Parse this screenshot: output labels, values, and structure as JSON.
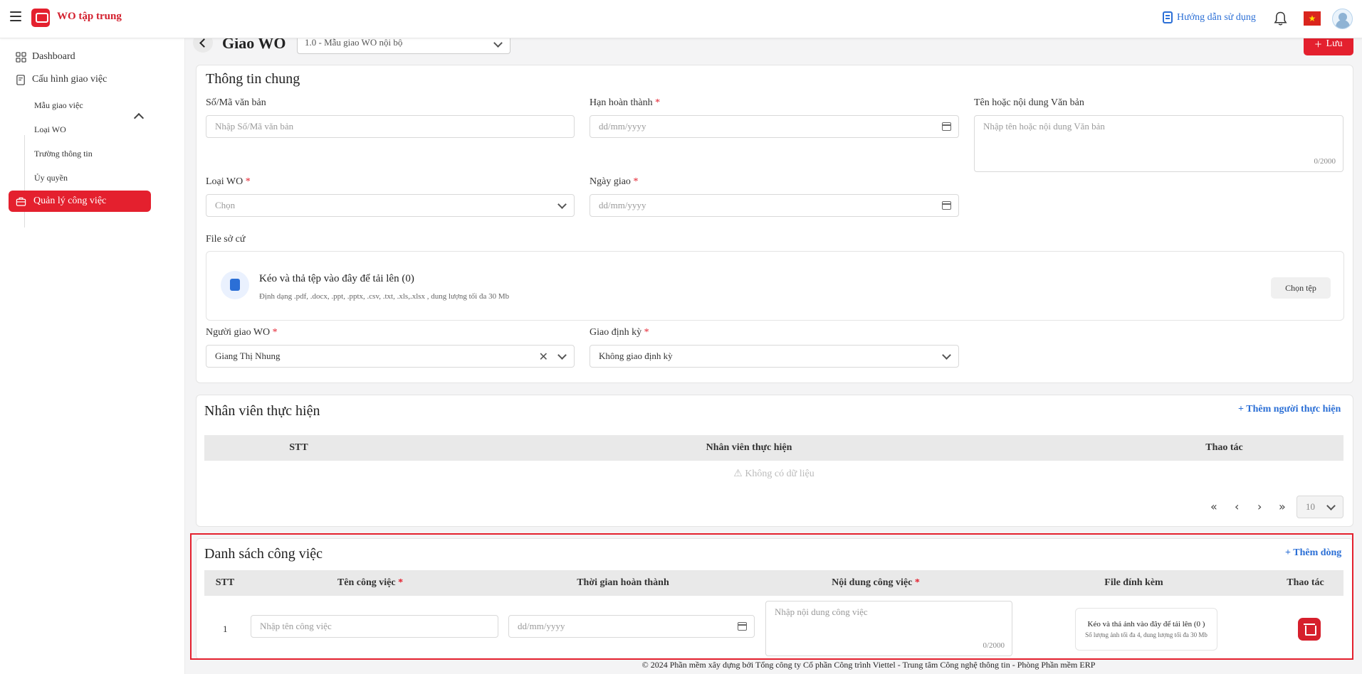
{
  "header": {
    "app_title": "WO tập trung",
    "guide_label": "Hướng dẫn sử dụng",
    "flag_symbol": "★",
    "brand_color": "#e4202e"
  },
  "sidebar": {
    "dashboard": "Dashboard",
    "config": "Cấu hình giao việc",
    "sub_items": [
      "Mẫu giao việc",
      "Loại WO",
      "Trường thông tin",
      "Ủy quyền"
    ],
    "active": "Quản lý công việc"
  },
  "page": {
    "title": "Giao WO",
    "template_value": "1.0 - Mẫu giao WO nội bộ",
    "save_label": "Lưu",
    "save_icon": "+"
  },
  "general": {
    "title": "Thông tin chung",
    "doc_no_label": "Số/Mã văn bản",
    "doc_no_placeholder": "Nhập Số/Mã văn bản",
    "deadline_label": "Hạn hoàn thành",
    "deadline_placeholder": "dd/mm/yyyy",
    "doc_name_label": "Tên hoặc nội dung Văn bản",
    "doc_name_placeholder": "Nhập tên hoặc nội dung Văn bản",
    "doc_name_counter": "0/2000",
    "wo_type_label": "Loại WO",
    "wo_type_placeholder": "Chọn",
    "assign_date_label": "Ngày giao",
    "assign_date_placeholder": "dd/mm/yyyy",
    "file_label": "File sở cứ",
    "dropzone_title": "Kéo và thả tệp vào đây để tải lên (0)",
    "dropzone_sub": "Định dạng .pdf, .docx, .ppt, .pptx, .csv, .txt, .xls,.xlsx , dung lượng tối đa 30 Mb",
    "choose_file": "Chọn tệp",
    "assigner_label": "Người giao WO",
    "assigner_value": "Giang Thị Nhung",
    "periodic_label": "Giao định kỳ",
    "periodic_value": "Không giao định kỳ",
    "required_mark": "*"
  },
  "staff": {
    "title": "Nhân viên thực hiện",
    "add_label": "+ Thêm người thực hiện",
    "columns": [
      "STT",
      "Nhân viên thực hiện",
      "Thao tác"
    ],
    "empty": "⚠ Không có dữ liệu",
    "pager": {
      "first": "«",
      "prev": "‹",
      "next": "›",
      "last": "»",
      "page_size": "10"
    }
  },
  "tasks": {
    "title": "Danh sách công việc",
    "add_label": "+ Thêm dòng",
    "columns": [
      "STT",
      "Tên công việc",
      "Thời gian hoàn thành",
      "Nội dung công việc",
      "File đính kèm",
      "Thao tác"
    ],
    "rows": [
      {
        "no": "1",
        "name_placeholder": "Nhập tên công việc",
        "date_placeholder": "dd/mm/yyyy",
        "content_placeholder": "Nhập nội dung công việc",
        "content_counter": "0/2000",
        "attach_title": "Kéo và thả ảnh vào đây để tải lên (0 )",
        "attach_sub": "Số lượng ảnh tối đa 4, dung lượng tối đa 30 Mb"
      }
    ]
  },
  "footer": "© 2024 Phần mềm xây dựng bởi Tổng công ty Cổ phần Công trình Viettel - Trung tâm Công nghệ thông tin - Phòng Phần mềm ERP"
}
